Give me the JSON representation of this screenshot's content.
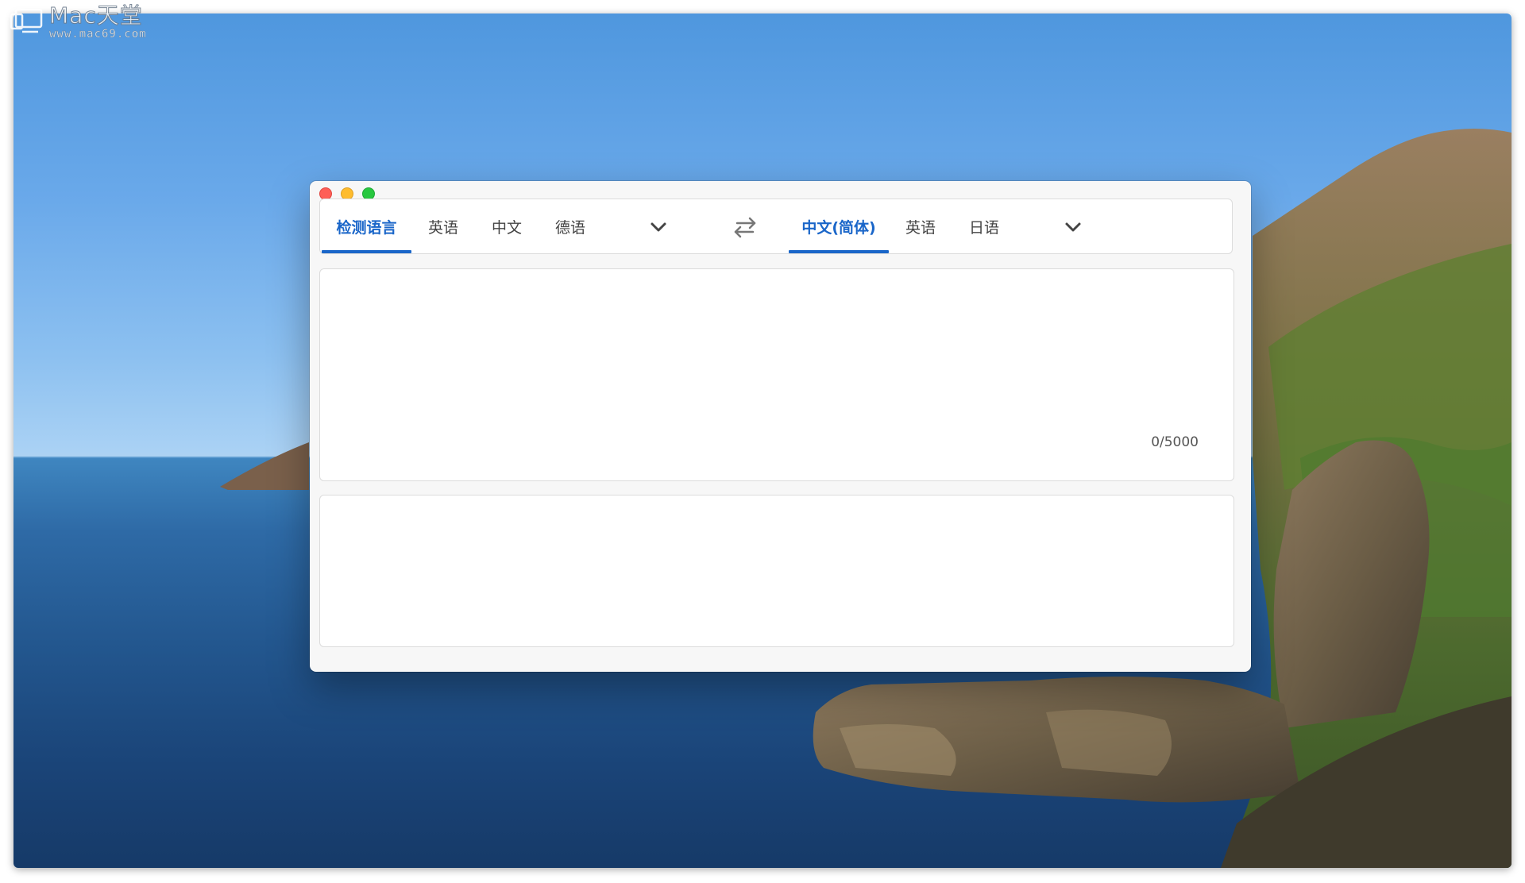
{
  "watermark": {
    "title": "Mac天堂",
    "url": "www.mac69.com"
  },
  "window": {
    "source_tabs": [
      {
        "label": "检测语言",
        "active": true
      },
      {
        "label": "英语",
        "active": false
      },
      {
        "label": "中文",
        "active": false
      },
      {
        "label": "德语",
        "active": false
      }
    ],
    "target_tabs": [
      {
        "label": "中文(简体)",
        "active": true
      },
      {
        "label": "英语",
        "active": false
      },
      {
        "label": "日语",
        "active": false
      }
    ],
    "input": {
      "value": "",
      "placeholder": "",
      "counter": "0/5000"
    },
    "output": {
      "value": ""
    }
  },
  "colors": {
    "accent": "#1a66c9",
    "close": "#fe5f57",
    "minimize": "#febc2e",
    "maximize": "#28c840"
  },
  "icons": {
    "source_more": "chevron-down-icon",
    "swap": "swap-arrows-icon",
    "target_more": "chevron-down-icon"
  }
}
